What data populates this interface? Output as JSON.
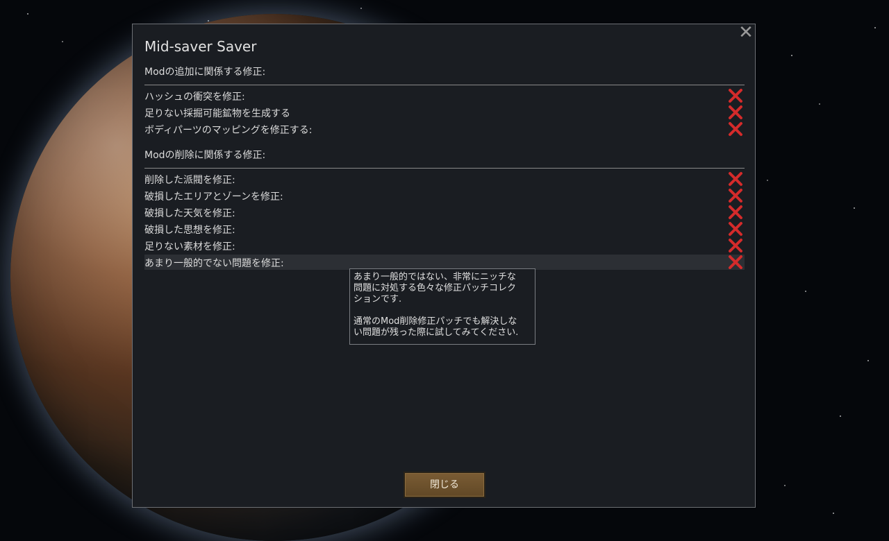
{
  "dialog": {
    "title": "Mid-saver Saver",
    "close_icon": "close-icon"
  },
  "sections": [
    {
      "header": "Modの追加に関係する修正:",
      "items": [
        {
          "label": "ハッシュの衝突を修正:",
          "state_icon": "x-icon"
        },
        {
          "label": "足りない採掘可能鉱物を生成する",
          "state_icon": "x-icon"
        },
        {
          "label": "ボディパーツのマッピングを修正する:",
          "state_icon": "x-icon"
        }
      ]
    },
    {
      "header": "Modの削除に関係する修正:",
      "items": [
        {
          "label": "削除した派閥を修正:",
          "state_icon": "x-icon"
        },
        {
          "label": "破損したエリアとゾーンを修正:",
          "state_icon": "x-icon"
        },
        {
          "label": "破損した天気を修正:",
          "state_icon": "x-icon"
        },
        {
          "label": "破損した思想を修正:",
          "state_icon": "x-icon"
        },
        {
          "label": "足りない素材を修正:",
          "state_icon": "x-icon"
        },
        {
          "label": "あまり一般的でない問題を修正:",
          "state_icon": "x-icon",
          "hovered": true
        }
      ]
    }
  ],
  "tooltip": {
    "text": "あまり一般的ではない、非常にニッチな\n問題に対処する色々な修正パッチコレク\nションです.\n\n通常のMod削除修正パッチでも解決しな\nい問題が残った際に試してみてください."
  },
  "footer": {
    "close_button_label": "閉じる"
  },
  "colors": {
    "x_icon": "#d42b2b",
    "button_bg": "#6b4f2c",
    "dialog_bg": "#1a1d22"
  }
}
